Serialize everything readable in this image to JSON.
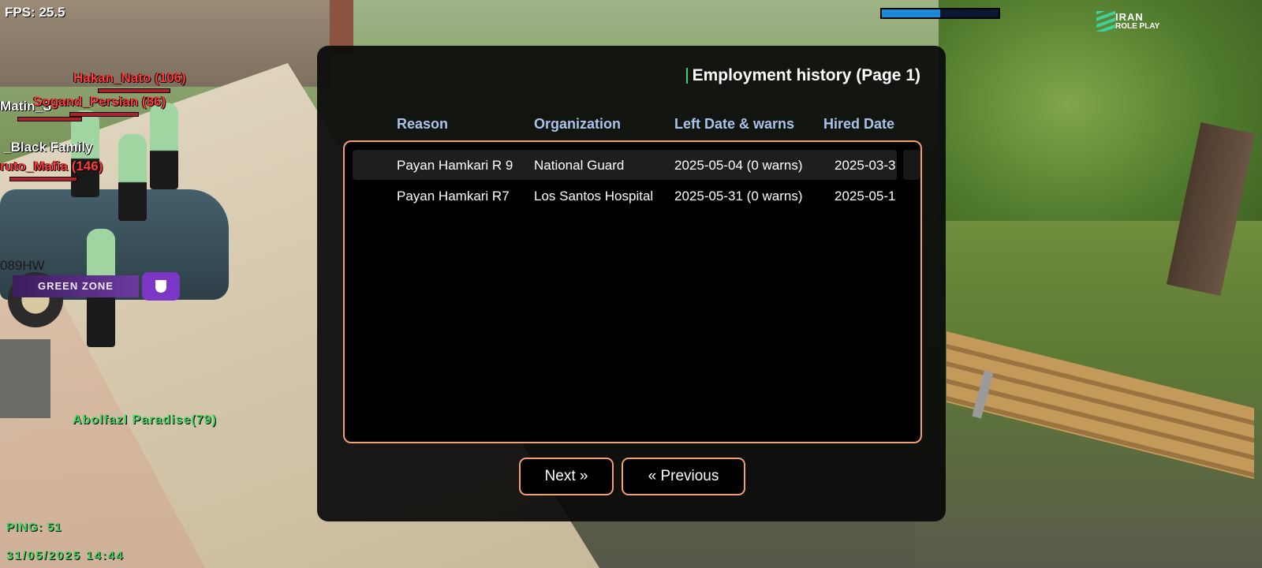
{
  "hud": {
    "fps": "FPS: 25.5",
    "ping": "PING: 51",
    "datetime": "31/05/2025 14:44",
    "player_name": "Abolfazl Paradise(79)",
    "vehicle_plate": "089HW",
    "green_zone": "GREEN ZONE",
    "loading_progress": 0.5,
    "logo_line1": "IRAN",
    "logo_line2": "ROLE PLAY",
    "nametags": [
      "Hakan_Nato (106)",
      "Sogand_Persian (86)",
      "Matin_S",
      "_Black Family",
      "ruto_Mafia (146)"
    ]
  },
  "dialog": {
    "title": "Employment history (Page 1)",
    "columns": [
      "Reason",
      "Organization",
      "Left Date & warns",
      "Hired Date"
    ],
    "rows": [
      {
        "reason": "Payan Hamkari R 9",
        "organization": "National Guard",
        "left": "2025-05-04 (0 warns)",
        "hired": "2025-03-3"
      },
      {
        "reason": "Payan Hamkari R7",
        "organization": "Los Santos Hospital",
        "left": "2025-05-31 (0 warns)",
        "hired": "2025-05-1"
      }
    ],
    "next_label": "Next »",
    "prev_label": "« Previous"
  },
  "colors": {
    "accent_border": "#f19f73",
    "header_text": "#a9c3ea",
    "title_marker": "#34d06b",
    "hud_green": "#3bd35a",
    "nametag_red": "#ff3b3b"
  }
}
